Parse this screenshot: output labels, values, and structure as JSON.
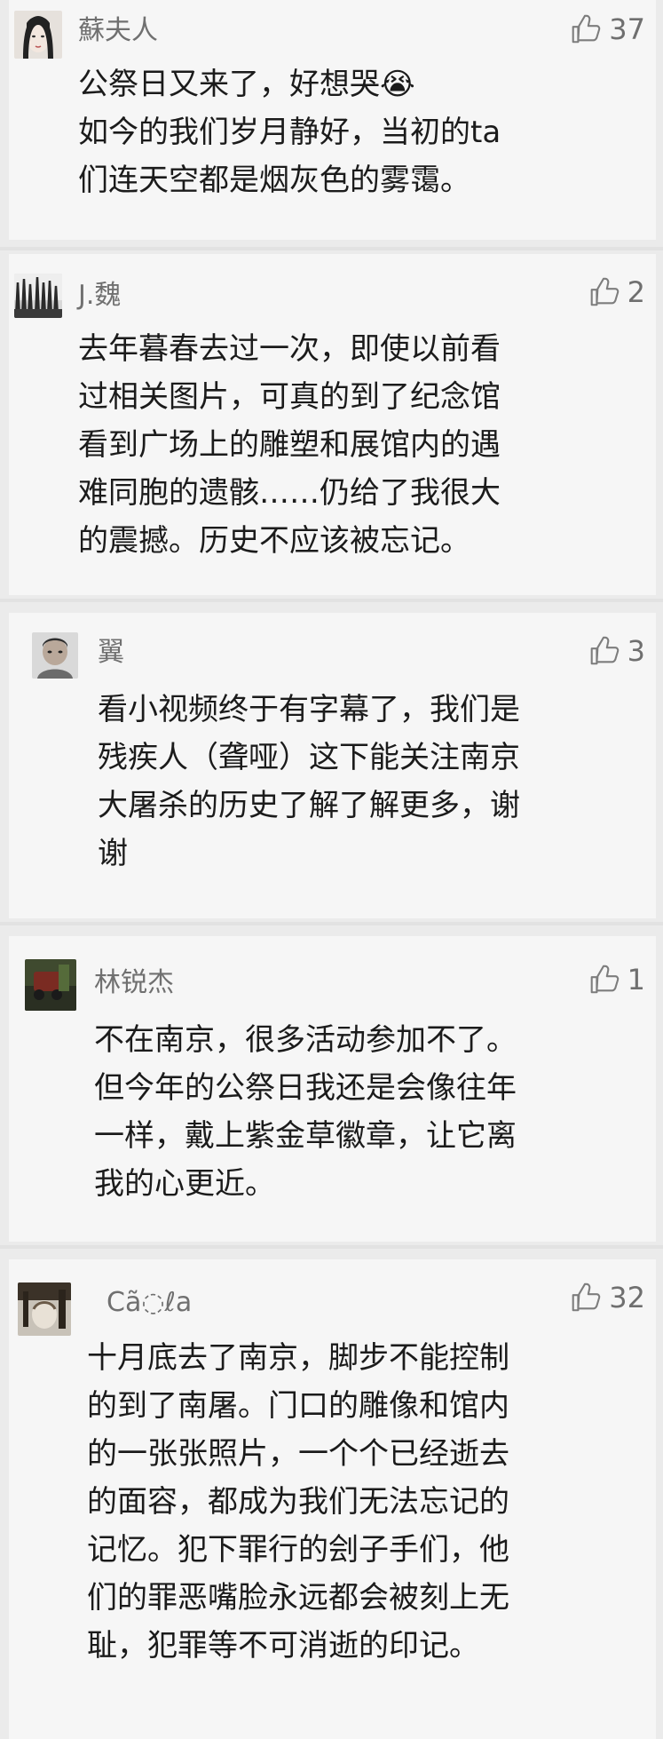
{
  "comments": [
    {
      "user": "蘇夫人",
      "likes": "37",
      "text": "公祭日又来了，好想哭😭\n如今的我们岁月静好，当初的ta\n们连天空都是烟灰色的雾霭。"
    },
    {
      "user": "J.魏",
      "likes": "2",
      "text": "去年暮春去过一次，即使以前看\n过相关图片，可真的到了纪念馆\n看到广场上的雕塑和展馆内的遇\n难同胞的遗骸……仍给了我很大\n的震撼。历史不应该被忘记。"
    },
    {
      "user": "翼",
      "likes": "3",
      "text": "看小视频终于有字幕了，我们是\n残疾人（聋哑）这下能关注南京\n大屠杀的历史了解了解更多，谢\n谢"
    },
    {
      "user": "林锐杰",
      "likes": "1",
      "text": "不在南京，很多活动参加不了。\n但今年的公祭日我还是会像往年\n一样，戴上紫金草徽章，让它离\n我的心更近。"
    },
    {
      "user": "Cã◌ℓa",
      "likes": "32",
      "text": "十月底去了南京，脚步不能控制\n的到了南屠。门口的雕像和馆内\n的一张张照片，一个个已经逝去\n的面容，都成为我们无法忘记的\n记忆。犯下罪行的刽子手们，他\n们的罪恶嘴脸永远都会被刻上无\n耻，犯罪等不可消逝的印记。"
    }
  ],
  "icons": {
    "like": "thumbs-up-outline-icon"
  },
  "colors": {
    "background": "#ebebeb",
    "card": "#f6f6f6",
    "username": "#707070",
    "text": "#1b1b1b"
  }
}
